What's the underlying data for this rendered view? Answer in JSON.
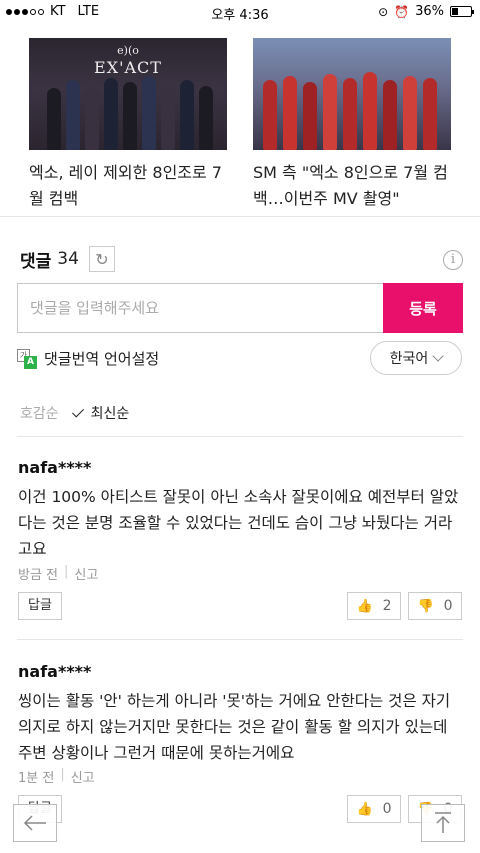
{
  "status_bar": {
    "carrier": "KT",
    "network": "LTE",
    "time": "오후 4:36",
    "battery": "36%",
    "battery_level": 0.36
  },
  "news": [
    {
      "image_logo_text": "EX'ACT",
      "image_logo_small": "e)(o",
      "title": "엑소, 레이 제외한 8인조로 7월 컴백"
    },
    {
      "title": "SM 측 \"엑소 8인으로 7월 컴백…이번주 MV 촬영\""
    }
  ],
  "comments_section": {
    "title": "댓글",
    "count": "34",
    "input_placeholder": "댓글을 입력해주세요",
    "submit_label": "등록",
    "translate_label": "댓글번역 언어설정",
    "translate_icon_a": "가",
    "translate_icon_b": "A",
    "language": "한국어",
    "sort_like": "호감순",
    "sort_new": "최신순"
  },
  "comments": [
    {
      "author": "nafa****",
      "text": "이건 100% 아티스트 잘못이 아닌 소속사 잘못이에요 예전부터 알았다는 것은 분명 조율할 수 있었다는 건데도 슴이 그냥 놔뒀다는 거라고요",
      "time": "방금 전",
      "report": "신고",
      "reply": "답글",
      "likes": "2",
      "dislikes": "0"
    },
    {
      "author": "nafa****",
      "text": "씽이는 활동 '안' 하는게 아니라 '못'하는 거에요 안한다는 것은 자기 의지로 하지 않는거지만 못한다는 것은 같이 활동 할 의지가 있는데 주변 상황이나 그런거 때문에 못하는거에요",
      "time": "1분 전",
      "report": "신고",
      "reply": "답글",
      "likes": "0",
      "dislikes": "0"
    }
  ],
  "colors": {
    "accent": "#e8106a",
    "translate_green": "#2db34a"
  },
  "icons": {
    "refresh": "refresh-icon",
    "info": "info-icon",
    "back": "back-arrow-icon",
    "top": "scroll-top-icon"
  }
}
